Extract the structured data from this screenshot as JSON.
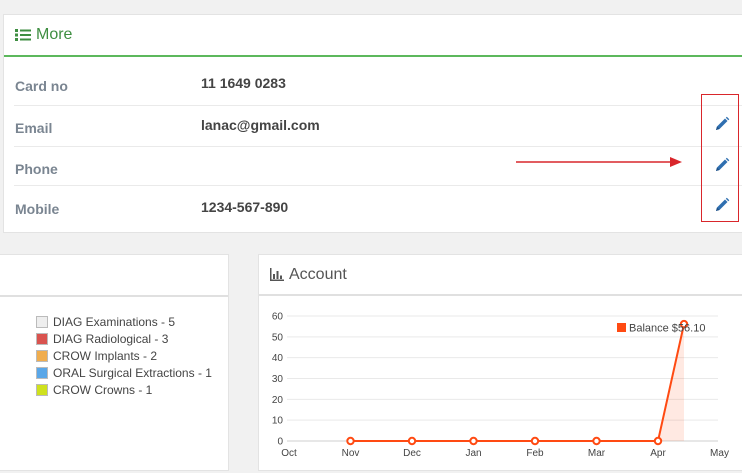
{
  "more": {
    "title": "More",
    "rows": [
      {
        "label": "Card no",
        "value": "11 1649 0283",
        "editable": false
      },
      {
        "label": "Email",
        "value": "lanac@gmail.com",
        "editable": true
      },
      {
        "label": "Phone",
        "value": "",
        "editable": true
      },
      {
        "label": "Mobile",
        "value": "1234-567-890",
        "editable": true
      }
    ]
  },
  "legend": {
    "items": [
      {
        "label": "DIAG Examinations - 5",
        "color": "#eeeeee"
      },
      {
        "label": "DIAG Radiological - 3",
        "color": "#d9534f"
      },
      {
        "label": "CROW Implants - 2",
        "color": "#f0ad4e"
      },
      {
        "label": "ORAL Surgical Extractions - 1",
        "color": "#5aa7e8"
      },
      {
        "label": "CROW Crowns - 1",
        "color": "#cfe11e"
      }
    ]
  },
  "account": {
    "title": "Account"
  },
  "colors": {
    "accent_green": "#5cb85c",
    "edit_blue": "#2f6fb0",
    "annotation_red": "#d9262b",
    "series_orange": "#ff4a12"
  },
  "chart_data": {
    "type": "line",
    "x": [
      "Oct",
      "Nov",
      "Dec",
      "Jan",
      "Feb",
      "Mar",
      "Apr",
      "May"
    ],
    "ylim": [
      0,
      60
    ],
    "yticks": [
      0,
      10,
      20,
      30,
      40,
      50,
      60
    ],
    "series": [
      {
        "name": "Balance $56.10",
        "points": [
          {
            "x": "Nov",
            "y": 0
          },
          {
            "x": "Dec",
            "y": 0
          },
          {
            "x": "Jan",
            "y": 0
          },
          {
            "x": "Feb",
            "y": 0
          },
          {
            "x": "Mar",
            "y": 0
          },
          {
            "x": "Apr",
            "y": 0
          },
          {
            "x": "Apr+",
            "y": 56.1
          }
        ]
      }
    ],
    "legend_placement": "top-right",
    "grid": true
  }
}
